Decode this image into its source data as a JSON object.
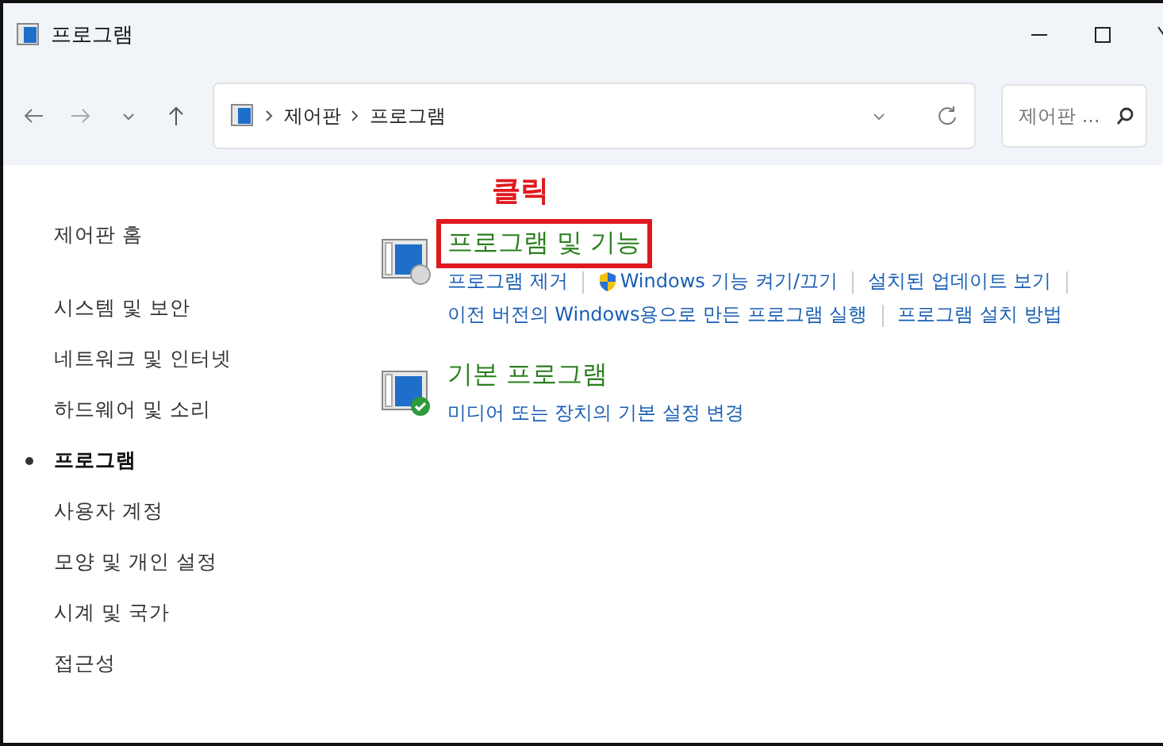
{
  "window": {
    "title": "프로그램"
  },
  "address": {
    "crumbs": [
      "제어판",
      "프로그램"
    ]
  },
  "search": {
    "placeholder": "제어판 ..."
  },
  "sidebar": {
    "items": [
      {
        "label": "제어판 홈",
        "selected": false,
        "kind": "home"
      },
      {
        "label": "시스템 및 보안",
        "selected": false,
        "kind": "item"
      },
      {
        "label": "네트워크 및 인터넷",
        "selected": false,
        "kind": "item"
      },
      {
        "label": "하드웨어 및 소리",
        "selected": false,
        "kind": "item"
      },
      {
        "label": "프로그램",
        "selected": true,
        "kind": "item"
      },
      {
        "label": "사용자 계정",
        "selected": false,
        "kind": "item"
      },
      {
        "label": "모양 및 개인 설정",
        "selected": false,
        "kind": "item"
      },
      {
        "label": "시계 및 국가",
        "selected": false,
        "kind": "item"
      },
      {
        "label": "접근성",
        "selected": false,
        "kind": "item"
      }
    ]
  },
  "annotation": {
    "label": "클릭"
  },
  "sections": [
    {
      "title": "프로그램 및 기능",
      "highlighted": true,
      "kind": "disc",
      "links": [
        [
          {
            "label": "프로그램 제거",
            "kind": "plain"
          },
          {
            "label": "Windows 기능 켜기/끄기",
            "kind": "shield"
          },
          {
            "label": "설치된 업데이트 보기",
            "kind": "plain"
          }
        ],
        [
          {
            "label": "이전 버전의 Windows용으로 만든 프로그램 실행",
            "kind": "plain"
          },
          {
            "label": "프로그램 설치 방법",
            "kind": "plain"
          }
        ]
      ]
    },
    {
      "title": "기본 프로그램",
      "highlighted": false,
      "kind": "check",
      "links": [
        [
          {
            "label": "미디어 또는 장치의 기본 설정 변경",
            "kind": "plain"
          }
        ]
      ]
    }
  ]
}
